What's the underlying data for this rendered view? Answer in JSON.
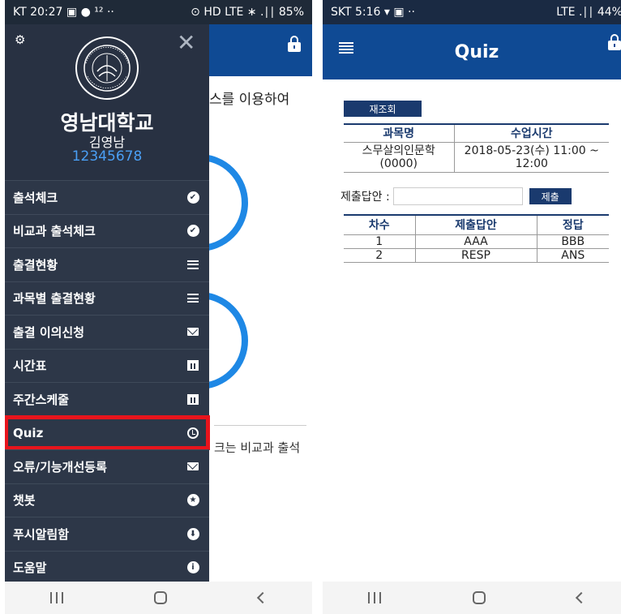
{
  "left_phone": {
    "status": {
      "carrier_time": "KT 20:27",
      "extra": "¹² ··",
      "right": "⊙ HD LTE ∗ .∣∣ 85%"
    },
    "background": {
      "text_top": "스를 이용하여",
      "text_bottom": "크는 비교과 출석"
    },
    "drawer": {
      "univ_name": "영남대학교",
      "user_name": "김영남",
      "user_id": "12345678",
      "logo_text": "YEUNGNAM UNIVERSITY 1947",
      "items": [
        {
          "label": "출석체크",
          "icon": "check-circle-icon"
        },
        {
          "label": "비교과 출석체크",
          "icon": "check-circle-icon"
        },
        {
          "label": "출결현황",
          "icon": "list-icon"
        },
        {
          "label": "과목별 출결현황",
          "icon": "list-icon"
        },
        {
          "label": "출결 이의신청",
          "icon": "mail-icon"
        },
        {
          "label": "시간표",
          "icon": "calendar-icon"
        },
        {
          "label": "주간스케줄",
          "icon": "calendar-icon"
        },
        {
          "label": "Quiz",
          "icon": "clock-icon",
          "highlighted": true
        },
        {
          "label": "오류/기능개선등록",
          "icon": "mail-icon"
        },
        {
          "label": "챗봇",
          "icon": "star-icon"
        },
        {
          "label": "푸시알림함",
          "icon": "download-icon"
        },
        {
          "label": "도움말",
          "icon": "info-icon"
        }
      ]
    }
  },
  "right_phone": {
    "status": {
      "carrier_time": "SKT 5:16",
      "extra": "··",
      "right": "LTE .∣∣ 44%"
    },
    "header": {
      "title": "Quiz"
    },
    "refresh_label": "재조회",
    "course_table": {
      "headers": [
        "과목명",
        "수업시간"
      ],
      "row": [
        "스무살의인문학 (0000)",
        "2018-05-23(수) 11:00 ~ 12:00"
      ]
    },
    "submit": {
      "label": "제출답안 :",
      "button": "제출",
      "value": ""
    },
    "quiz_table": {
      "headers": [
        "차수",
        "제출답안",
        "정답"
      ],
      "rows": [
        [
          "1",
          "AAA",
          "BBB"
        ],
        [
          "2",
          "RESP",
          "ANS"
        ]
      ]
    }
  },
  "colors": {
    "header_blue": "#0f4a94",
    "drawer_bg": "#2d3748",
    "highlight_red": "#e8141c",
    "accent_blue": "#1e88e5"
  }
}
